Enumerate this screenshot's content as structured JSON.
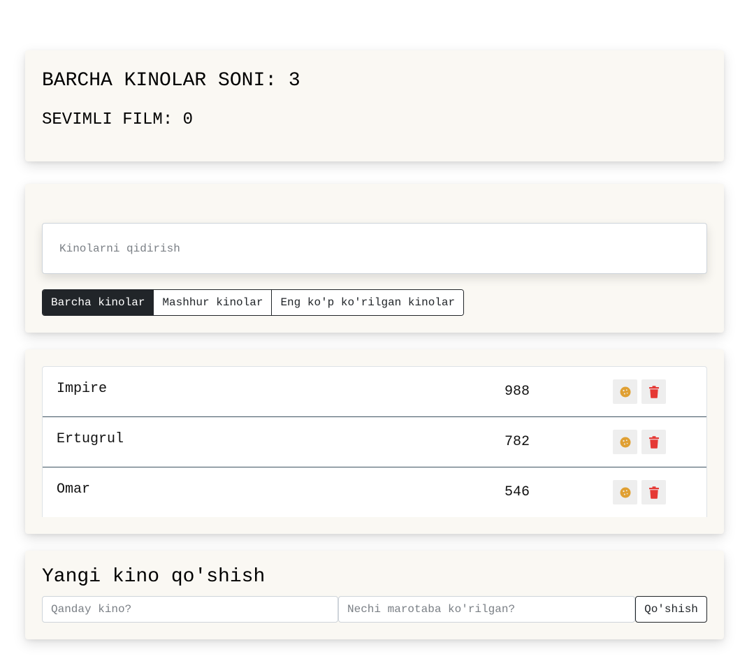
{
  "info": {
    "total_label": "BARCHA KINOLAR SONI: 3",
    "favorite_label": "SEVIMLI FILM: 0"
  },
  "search": {
    "placeholder": "Kinolarni qidirish",
    "filters": [
      {
        "label": "Barcha kinolar",
        "active": true
      },
      {
        "label": "Mashhur kinolar",
        "active": false
      },
      {
        "label": "Eng ko'p ko'rilgan kinolar",
        "active": false
      }
    ]
  },
  "movies": [
    {
      "name": "Impire",
      "views": "988"
    },
    {
      "name": "Ertugrul",
      "views": "782"
    },
    {
      "name": "Omar",
      "views": "546"
    }
  ],
  "add_form": {
    "title": "Yangi kino qo'shish",
    "name_placeholder": "Qanday kino?",
    "views_placeholder": "Nechi marotaba ko'rilgan?",
    "submit_label": "Qo'shish"
  },
  "colors": {
    "favorite_icon": "#e0a033",
    "delete_icon": "#e53935",
    "active_filter_bg": "#212529",
    "card_bg": "#faf8f3"
  },
  "icons": {
    "favorite": "cookie-icon",
    "delete": "trash-icon"
  }
}
